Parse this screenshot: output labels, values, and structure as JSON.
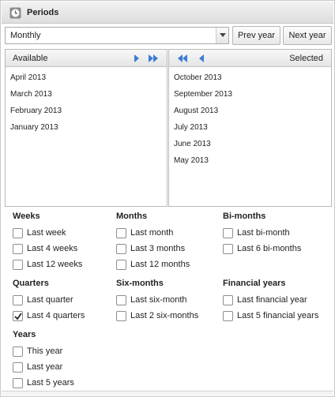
{
  "header": {
    "title": "Periods",
    "icon": "clock-icon"
  },
  "period_type": {
    "selected": "Monthly"
  },
  "buttons": {
    "prev": "Prev year",
    "next": "Next year"
  },
  "available": {
    "label": "Available",
    "items": [
      "April 2013",
      "March 2013",
      "February 2013",
      "January 2013"
    ]
  },
  "selected": {
    "label": "Selected",
    "items": [
      "October 2013",
      "September 2013",
      "August 2013",
      "July 2013",
      "June 2013",
      "May 2013"
    ]
  },
  "groups": {
    "weeks": {
      "title": "Weeks",
      "options": [
        {
          "label": "Last week",
          "checked": false
        },
        {
          "label": "Last 4 weeks",
          "checked": false
        },
        {
          "label": "Last 12 weeks",
          "checked": false
        }
      ]
    },
    "months": {
      "title": "Months",
      "options": [
        {
          "label": "Last month",
          "checked": false
        },
        {
          "label": "Last 3 months",
          "checked": false
        },
        {
          "label": "Last 12 months",
          "checked": false
        }
      ]
    },
    "bimonths": {
      "title": "Bi-months",
      "options": [
        {
          "label": "Last bi-month",
          "checked": false
        },
        {
          "label": "Last 6 bi-months",
          "checked": false
        }
      ]
    },
    "quarters": {
      "title": "Quarters",
      "options": [
        {
          "label": "Last quarter",
          "checked": false
        },
        {
          "label": "Last 4 quarters",
          "checked": true
        }
      ]
    },
    "sixmonths": {
      "title": "Six-months",
      "options": [
        {
          "label": "Last six-month",
          "checked": false
        },
        {
          "label": "Last 2 six-months",
          "checked": false
        }
      ]
    },
    "financial": {
      "title": "Financial years",
      "options": [
        {
          "label": "Last financial year",
          "checked": false
        },
        {
          "label": "Last 5 financial years",
          "checked": false
        }
      ]
    },
    "years": {
      "title": "Years",
      "options": [
        {
          "label": "This year",
          "checked": false
        },
        {
          "label": "Last year",
          "checked": false
        },
        {
          "label": "Last 5 years",
          "checked": false
        }
      ]
    }
  },
  "colors": {
    "accent": "#3c7bd6",
    "border": "#b9b9b9"
  }
}
